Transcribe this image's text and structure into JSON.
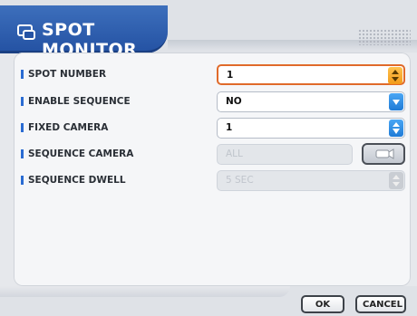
{
  "window": {
    "title": "SPOT MONITOR",
    "title_icon": "monitor-icon"
  },
  "form": {
    "rows": [
      {
        "label": "SPOT NUMBER",
        "value": "1",
        "control": "stepper",
        "accent": "#f29a1a",
        "focused": true,
        "enabled": true
      },
      {
        "label": "ENABLE SEQUENCE",
        "value": "NO",
        "control": "dropdown",
        "accent": "#1f7bd6",
        "focused": false,
        "enabled": true
      },
      {
        "label": "FIXED CAMERA",
        "value": "1",
        "control": "stepper",
        "accent": "#1f7bd6",
        "focused": false,
        "enabled": true
      },
      {
        "label": "SEQUENCE CAMERA",
        "value": "ALL",
        "control": "select-button",
        "accent": "#c9cdd3",
        "focused": false,
        "enabled": false
      },
      {
        "label": "SEQUENCE DWELL",
        "value": "5 SEC",
        "control": "stepper",
        "accent": "#c9cdd3",
        "focused": false,
        "enabled": false
      }
    ]
  },
  "footer": {
    "ok_label": "OK",
    "cancel_label": "CANCEL"
  }
}
